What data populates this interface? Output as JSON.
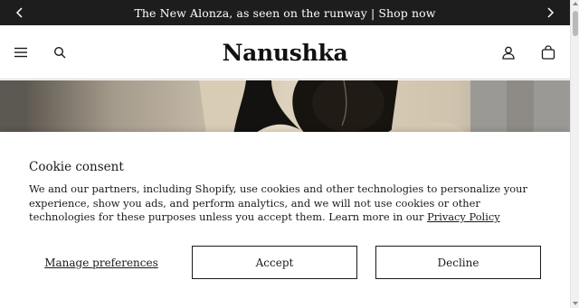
{
  "announcement": {
    "text": "The New Alonza, as seen on the runway | Shop now"
  },
  "header": {
    "logo": "Nanushka"
  },
  "consent": {
    "title": "Cookie consent",
    "body_prefix": "We and our partners, including Shopify, use cookies and other technologies to personalize your experience, show you ads, and perform analytics, and we will not use cookies or other technologies for these purposes unless you accept them. Learn more in our ",
    "privacy_link": "Privacy Policy",
    "manage_label": "Manage preferences",
    "accept_label": "Accept",
    "decline_label": "Decline"
  },
  "icons": {
    "announce_prev": "chevron-left-icon",
    "announce_next": "chevron-right-icon",
    "menu": "hamburger-menu-icon",
    "search": "search-icon",
    "account": "user-icon",
    "cart": "shopping-bag-icon"
  },
  "colors": {
    "announcement_bg": "#1d1d1d",
    "text": "#1a1a1a",
    "background": "#ffffff"
  }
}
